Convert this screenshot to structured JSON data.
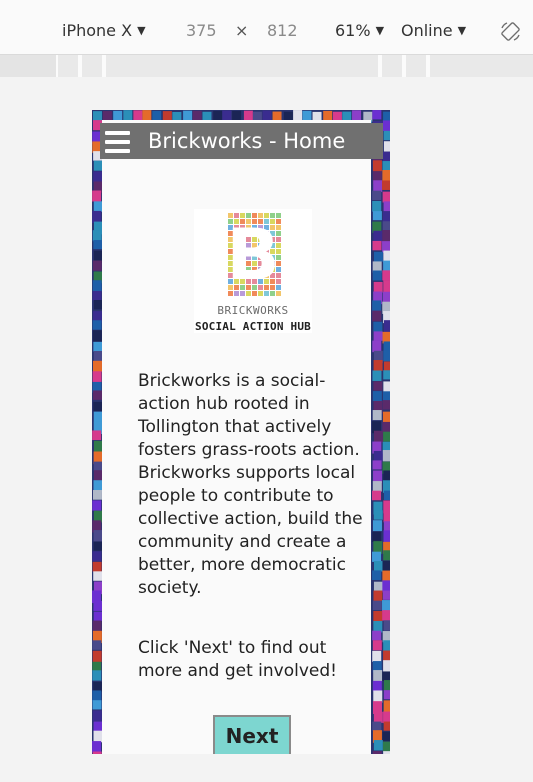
{
  "devtools": {
    "device_name": "iPhone X",
    "width": "375",
    "times": "×",
    "height": "812",
    "zoom": "61%",
    "network": "Online",
    "dropdown_arrow": "▼",
    "rotate_icon": "rotate-icon"
  },
  "app": {
    "title": "Brickworks - Home",
    "menu_icon": "hamburger-menu-icon"
  },
  "logo": {
    "letter": "B",
    "line1": "BRICKWORKS",
    "line2": "SOCIAL ACTION HUB"
  },
  "content": {
    "paragraph1": "Brickworks is a social-action hub rooted in Tollington that actively fosters grass-roots action. Brickworks supports local people to contribute to collective action, build the community and create a better, more democratic society.",
    "paragraph2": "Click 'Next' to find out more and get involved!",
    "next_label": "Next"
  }
}
